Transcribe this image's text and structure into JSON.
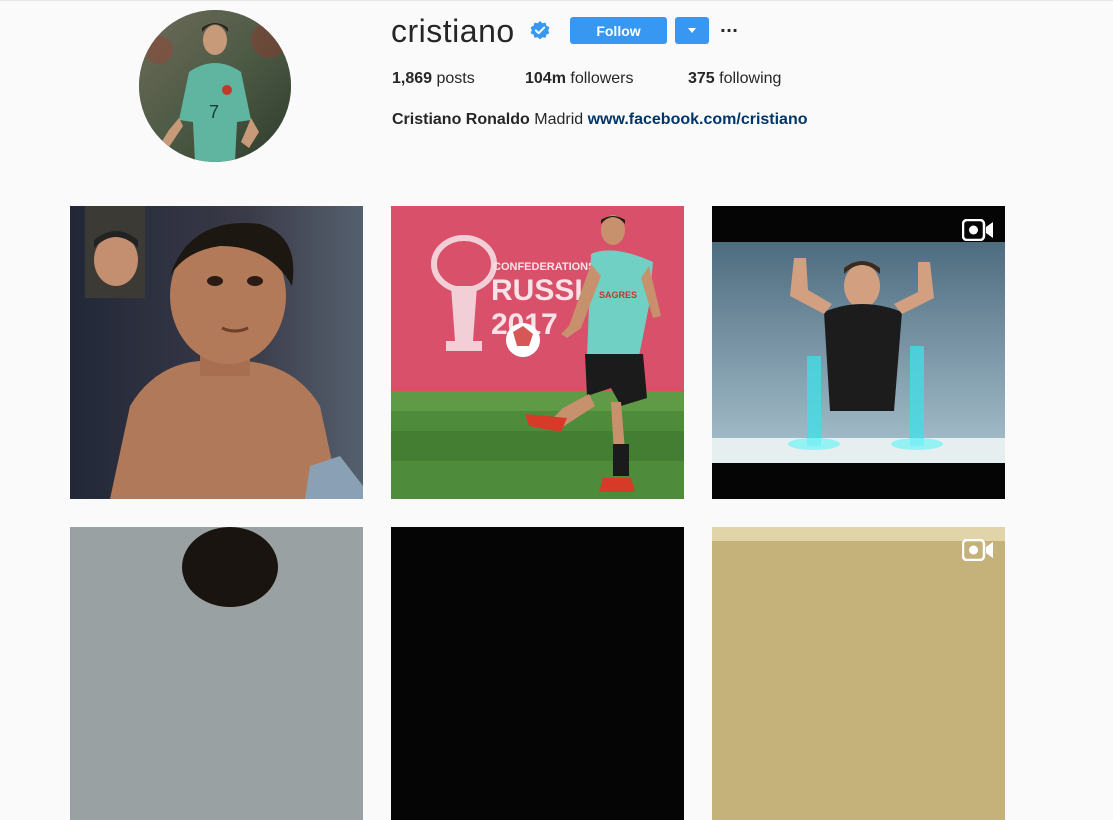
{
  "profile": {
    "username": "cristiano",
    "follow_label": "Follow",
    "more_label": "···",
    "stats": {
      "posts_count": "1,869",
      "posts_label": "posts",
      "followers_count": "104m",
      "followers_label": "followers",
      "following_count": "375",
      "following_label": "following"
    },
    "bio": {
      "name": "Cristiano Ronaldo",
      "location": "Madrid",
      "link": "www.facebook.com/cristiano"
    }
  },
  "posts": [
    {
      "kind": "photo",
      "icon": "none"
    },
    {
      "kind": "photo",
      "icon": "none",
      "banner_line1": "CONFEDERATIONS CUP",
      "banner_line2": "RUSSIA",
      "banner_line3": "2017",
      "shirt_text": "SAGRES"
    },
    {
      "kind": "video",
      "icon": "video-camera-icon"
    },
    {
      "kind": "photo",
      "icon": "none"
    },
    {
      "kind": "photo",
      "icon": "none"
    },
    {
      "kind": "video",
      "icon": "video-camera-icon"
    }
  ],
  "colors": {
    "accent": "#3897f0",
    "link": "#003569",
    "verified": "#3897f0",
    "background": "#fafafa"
  }
}
